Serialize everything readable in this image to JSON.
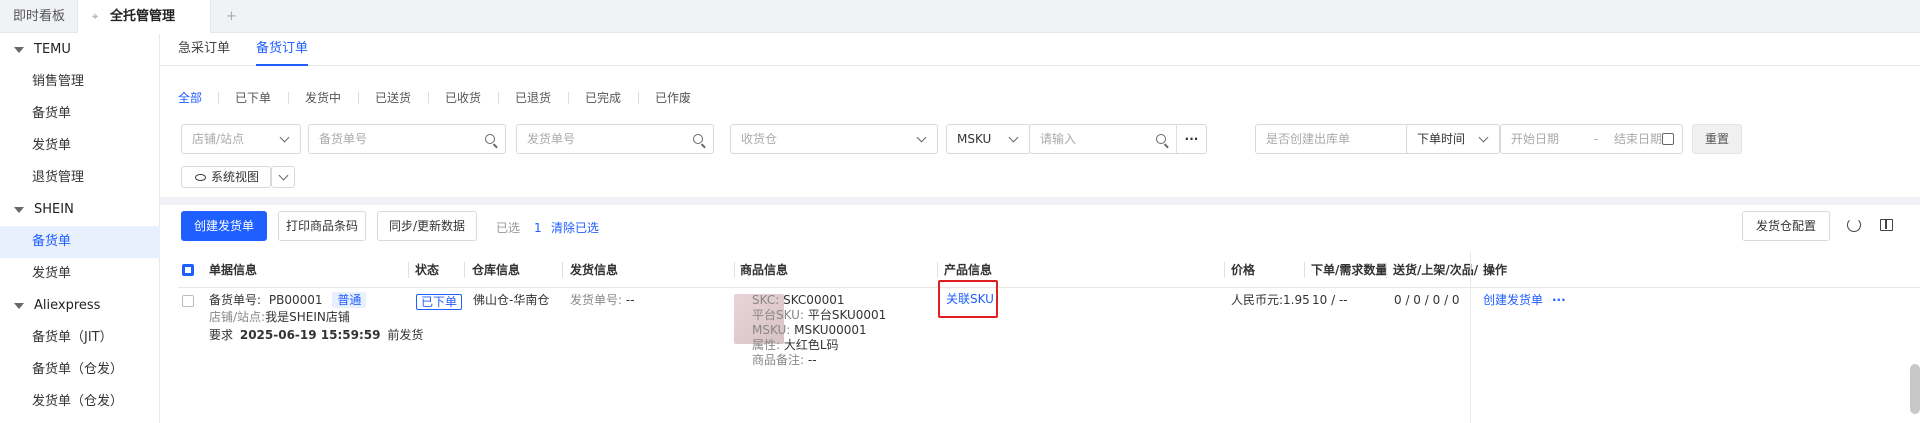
{
  "topbar": {
    "tab_dashboard": "即时看板",
    "tab_active": "全托管管理",
    "tab_add": "+"
  },
  "sidebar": {
    "groups": [
      {
        "label": "TEMU",
        "items": [
          "销售管理",
          "备货单",
          "发货单",
          "退货管理"
        ]
      },
      {
        "label": "SHEIN",
        "items": [
          "备货单",
          "发货单"
        ]
      },
      {
        "label": "Aliexpress",
        "items": [
          "备货单（JIT）",
          "备货单（仓发）",
          "发货单（仓发）"
        ]
      }
    ],
    "active_item": "SHEIN / 备货单"
  },
  "subtabs": [
    "急采订单",
    "备货订单"
  ],
  "status_filters": [
    "全部",
    "已下单",
    "发货中",
    "已送货",
    "已收货",
    "已退货",
    "已完成",
    "已作废"
  ],
  "filters": {
    "shop_placeholder": "店铺/站点",
    "stock_order_placeholder": "备货单号",
    "ship_order_placeholder": "发货单号",
    "warehouse_placeholder": "收货仓",
    "msku_select": "MSKU",
    "msku_placeholder": "请输入",
    "more": "···",
    "outbound_placeholder": "是否创建出库单",
    "time_select": "下单时间",
    "start_date": "开始日期",
    "date_sep": "-",
    "end_date": "结束日期",
    "reset": "重置",
    "system_view": "系统视图"
  },
  "toolbar": {
    "create_shipment": "创建发货单",
    "print_barcode": "打印商品条码",
    "sync_data": "同步/更新数据",
    "selected_label": "已选",
    "selected_count": "1",
    "clear_selected": "清除已选",
    "warehouse_config": "发货仓配置"
  },
  "table": {
    "headers": [
      "单据信息",
      "状态",
      "仓库信息",
      "发货信息",
      "商品信息",
      "产品信息",
      "价格",
      "下单/需求数量",
      "送货/上架/次品/",
      "操作"
    ],
    "row": {
      "order_label": "备货单号:",
      "order_no": "PB00001",
      "order_tag": "普通",
      "shop_label": "店铺/站点:",
      "shop": "我是SHEIN店铺",
      "req_prefix": "要求",
      "req_time": "2025-06-19 15:59:59",
      "req_suffix": "前发货",
      "status": "已下单",
      "warehouse": "佛山仓-华南仓",
      "ship_label": "发货单号:",
      "ship_value": "--",
      "skc_label": "SKC:",
      "skc": "SKC00001",
      "platform_sku_label": "平台SKU:",
      "platform_sku": "平台SKU0001",
      "msku_label": "MSKU:",
      "msku": "MSKU00001",
      "attr_label": "属性:",
      "attr": "大红色L码",
      "remark_label": "商品备注:",
      "remark": "--",
      "link_sku": "关联SKU",
      "price": "人民币元:1.95",
      "qty": "10 / --",
      "delivery": "0 / 0 / 0 / 0",
      "action": "创建发货单",
      "action_more": "···"
    }
  },
  "colors": {
    "accent": "#1f5eff",
    "highlight": "#e02020"
  }
}
